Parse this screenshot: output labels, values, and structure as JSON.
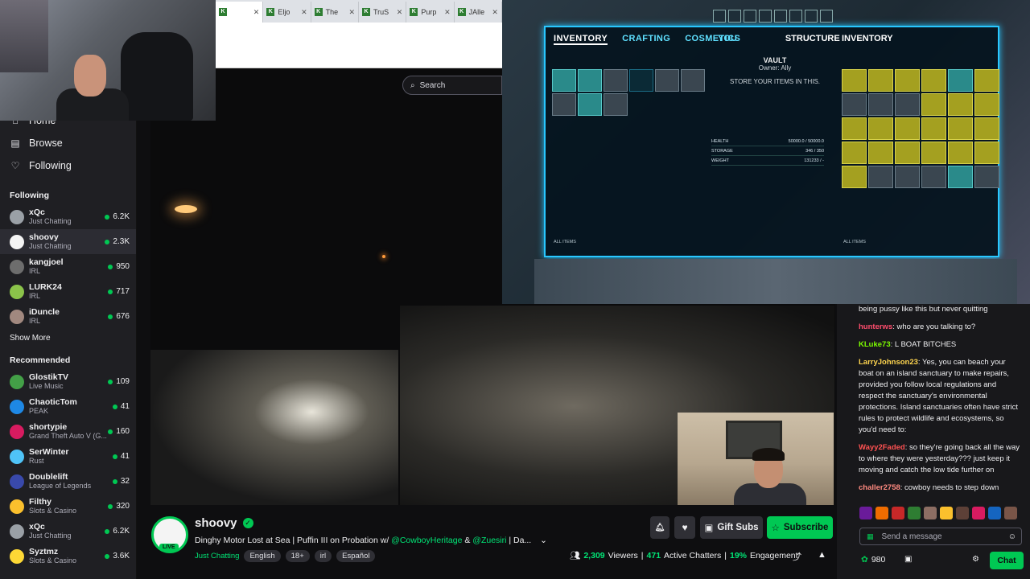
{
  "sidebar": {
    "nav": [
      {
        "label": "Home",
        "icon": "home-icon"
      },
      {
        "label": "Browse",
        "icon": "browse-icon"
      },
      {
        "label": "Following",
        "icon": "heart-icon"
      }
    ],
    "following_heading": "Following",
    "following": [
      {
        "name": "xQc",
        "category": "Just Chatting",
        "viewers": "6.2K",
        "avatar_color": "#9aa0a6"
      },
      {
        "name": "shoovy",
        "category": "Just Chatting",
        "viewers": "2.3K",
        "avatar_color": "#f4f4f4",
        "active": true
      },
      {
        "name": "kangjoel",
        "category": "IRL",
        "viewers": "950",
        "avatar_color": "#6d6d6d"
      },
      {
        "name": "LURK24",
        "category": "IRL",
        "viewers": "717",
        "avatar_color": "#8bc34a"
      },
      {
        "name": "iDuncle",
        "category": "IRL",
        "viewers": "676",
        "avatar_color": "#a1887f"
      }
    ],
    "show_more": "Show More",
    "recommended_heading": "Recommended",
    "recommended": [
      {
        "name": "GlostikTV",
        "category": "Live Music",
        "viewers": "109",
        "avatar_color": "#43a047"
      },
      {
        "name": "ChaoticTom",
        "category": "PEAK",
        "viewers": "41",
        "avatar_color": "#1e88e5"
      },
      {
        "name": "shortypie",
        "category": "Grand Theft Auto V (G...",
        "viewers": "160",
        "avatar_color": "#d81b60"
      },
      {
        "name": "SerWinter",
        "category": "Rust",
        "viewers": "41",
        "avatar_color": "#4fc3f7"
      },
      {
        "name": "Doublelift",
        "category": "League of Legends",
        "viewers": "32",
        "avatar_color": "#3949ab"
      },
      {
        "name": "Filthy",
        "category": "Slots & Casino",
        "viewers": "320",
        "avatar_color": "#fbc02d"
      },
      {
        "name": "xQc",
        "category": "Just Chatting",
        "viewers": "6.2K",
        "avatar_color": "#9aa0a6"
      },
      {
        "name": "Syztmz",
        "category": "Slots & Casino",
        "viewers": "3.6K",
        "avatar_color": "#fdd835"
      }
    ]
  },
  "browser": {
    "tabs": [
      "",
      "Eljo",
      "The",
      "TruS",
      "Purp",
      "JAlle"
    ]
  },
  "search": {
    "placeholder": "Search"
  },
  "ark": {
    "tabs_left": [
      "INVENTORY",
      "CRAFTING",
      "COSMETICS"
    ],
    "tab_you": "YOU",
    "tab_structure": "STRUCTURE",
    "tab_right": "INVENTORY",
    "vault_title": "VAULT",
    "vault_owner": "Owner: Ally",
    "vault_hint": "STORE YOUR ITEMS IN THIS.",
    "stats": [
      {
        "label": "HEALTH",
        "value": "50000.0 / 50000.0"
      },
      {
        "label": "STORAGE",
        "value": "346 / 350"
      },
      {
        "label": "WEIGHT",
        "value": "131233 / -"
      }
    ],
    "all_items": "ALL ITEMS"
  },
  "stream": {
    "channel": "shoovy",
    "live_badge": "LIVE",
    "title_prefix": "Dinghy Motor Lost at Sea | Puffin III on Probation w/ ",
    "mention1": "@CowboyHeritage",
    "amp": " & ",
    "mention2": "@Zuesiri",
    "title_suffix": " | Da...",
    "category": "Just Chatting",
    "tags": [
      "English",
      "18+",
      "irl",
      "Español"
    ],
    "viewers": "2,309",
    "viewers_label": "Viewers",
    "chatters": "471",
    "chatters_label": "Active Chatters",
    "engagement": "19%",
    "engagement_label": "Engagement",
    "gift_label": "Gift Subs",
    "subscribe_label": "Subscribe"
  },
  "chat": {
    "messages": [
      {
        "user": "",
        "text": "being pussy like this but never quitting",
        "color": ""
      },
      {
        "user": "hunterws",
        "text": ": who are you talking to?",
        "color": "u1"
      },
      {
        "user": "KLuke73",
        "text": ":  L BOAT BITCHES ",
        "color": "u2",
        "emote": true
      },
      {
        "user": "LarryJohnson23",
        "text": ": Yes, you can beach your boat on an island sanctuary to make repairs, provided you follow local regulations and respect the sanctuary's environmental protections. Island sanctuaries often have strict rules to protect wildlife and ecosystems, so you'd need to:",
        "color": "u3"
      },
      {
        "user": "Wayy2Faded",
        "text": ": so they're going back all the way to where they were yesterday??? just keep it moving and catch the low tide further on",
        "color": "u4"
      },
      {
        "user": "challer2758",
        "text": ": cowboy needs to step down",
        "color": "u5"
      }
    ],
    "input_placeholder": "Send a message",
    "points": "980",
    "chat_button": "Chat"
  }
}
